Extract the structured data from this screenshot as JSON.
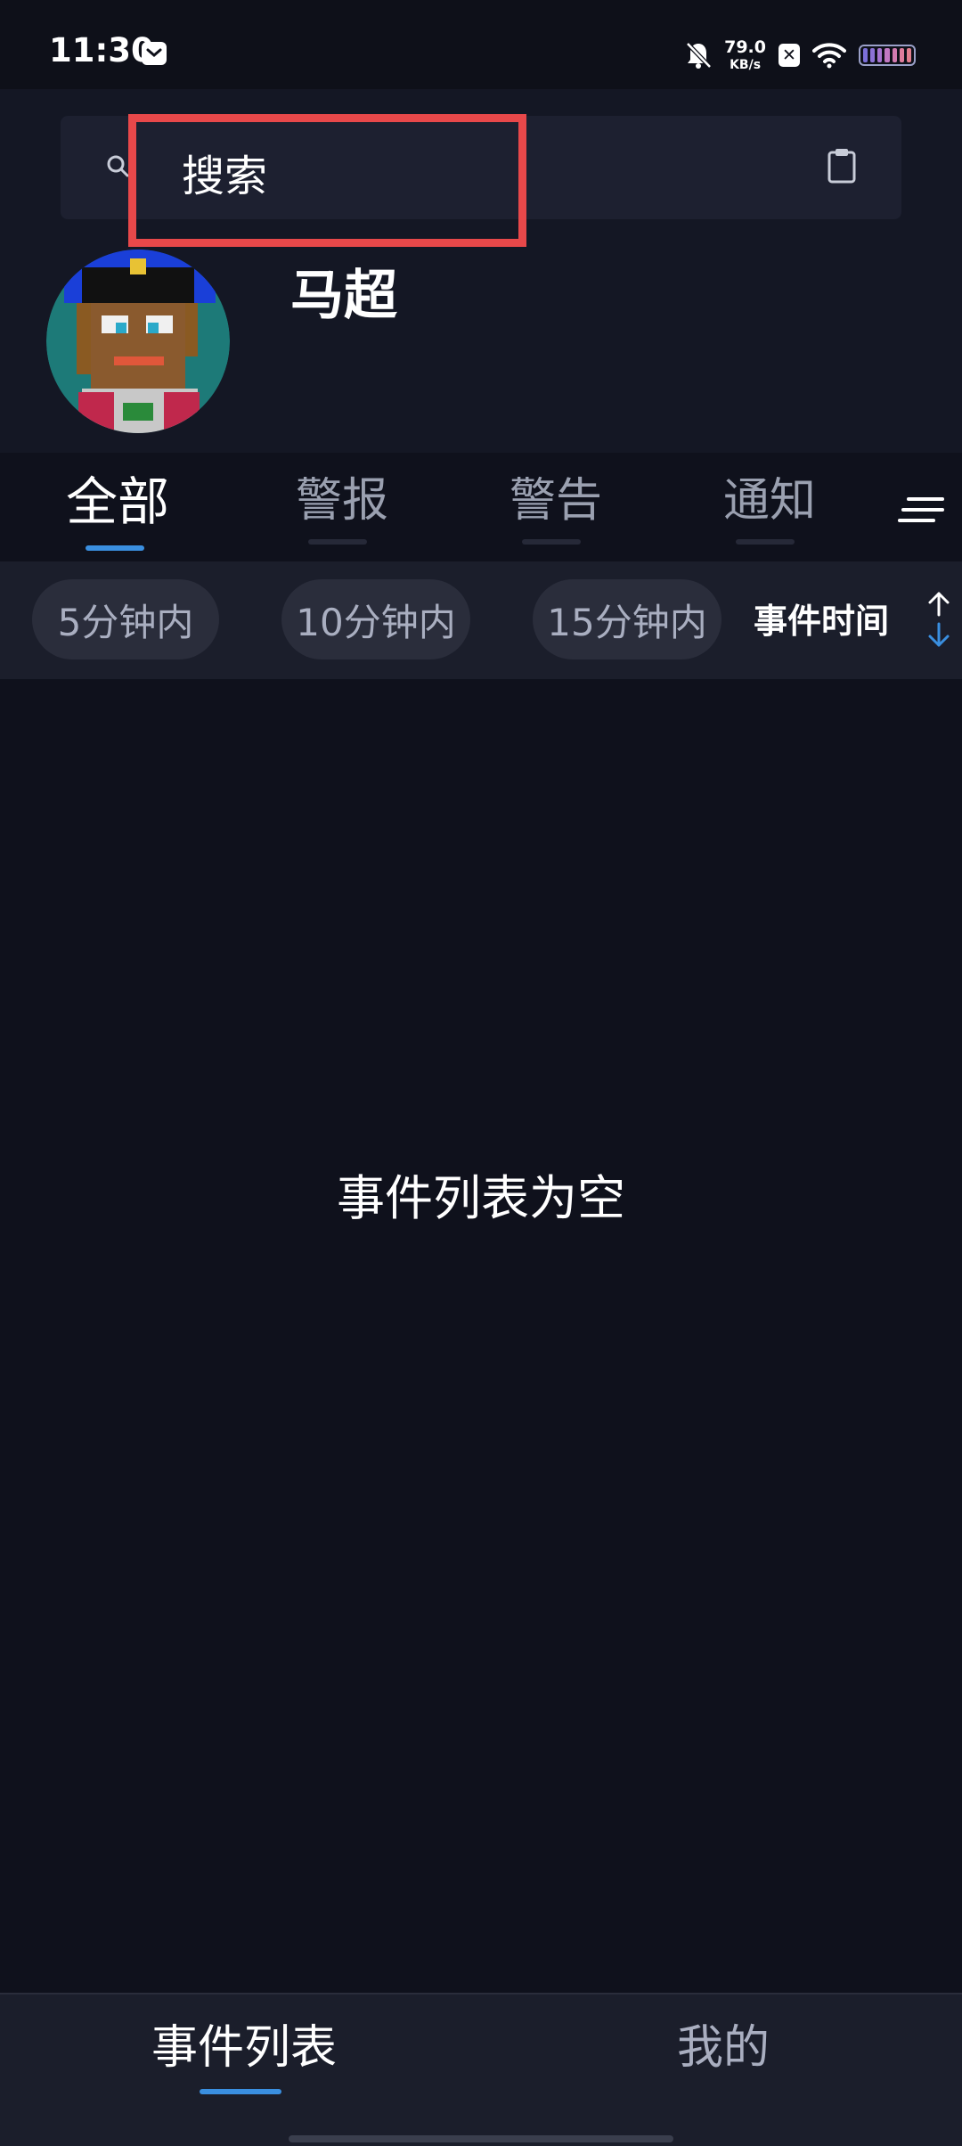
{
  "status_bar": {
    "time": "11:30",
    "net_speed_value": "79.0",
    "net_speed_unit": "KB/s",
    "x_badge": "✕",
    "icons": [
      "message-icon",
      "bell-muted-icon",
      "x-app-icon",
      "wifi-icon",
      "battery-icon"
    ]
  },
  "search": {
    "placeholder": "搜索",
    "icon": "search-icon",
    "clipboard_icon": "clipboard-icon"
  },
  "profile": {
    "username": "马超",
    "avatar_icon": "pixel-avatar"
  },
  "tabs": [
    {
      "label": "全部",
      "active": true
    },
    {
      "label": "警报",
      "active": false
    },
    {
      "label": "警告",
      "active": false
    },
    {
      "label": "通知",
      "active": false
    }
  ],
  "filters": {
    "chips": [
      "5分钟内",
      "10分钟内",
      "15分钟内"
    ],
    "sort_label": "事件时间"
  },
  "empty_state": {
    "message": "事件列表为空"
  },
  "bottom_nav": {
    "items": [
      {
        "label": "事件列表",
        "active": true
      },
      {
        "label": "我的",
        "active": false
      }
    ]
  },
  "colors": {
    "accent": "#3a8fe0",
    "highlight": "#e8484a",
    "background": "#0f111c"
  }
}
